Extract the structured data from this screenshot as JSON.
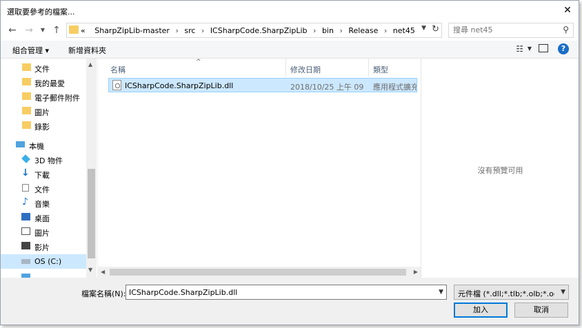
{
  "window": {
    "title": "選取要參考的檔案..."
  },
  "address": {
    "overflow": "«",
    "crumbs": [
      "SharpZipLib-master",
      "src",
      "ICSharpCode.SharpZipLib",
      "bin",
      "Release",
      "net45"
    ],
    "search_placeholder": "搜尋 net45"
  },
  "toolbar": {
    "organize": "組合管理 ▾",
    "new_folder": "新增資料夾",
    "help": "?"
  },
  "sidebar": {
    "items": [
      {
        "label": "文件",
        "icon": "folder"
      },
      {
        "label": "我的最愛",
        "icon": "folder"
      },
      {
        "label": "電子郵件附件",
        "icon": "folder"
      },
      {
        "label": "圖片",
        "icon": "folder"
      },
      {
        "label": "錄影",
        "icon": "folder"
      },
      {
        "label": "本機",
        "icon": "computer"
      },
      {
        "label": "3D 物件",
        "icon": "3d-objects"
      },
      {
        "label": "下載",
        "icon": "download"
      },
      {
        "label": "文件",
        "icon": "document"
      },
      {
        "label": "音樂",
        "icon": "music"
      },
      {
        "label": "桌面",
        "icon": "desktop"
      },
      {
        "label": "圖片",
        "icon": "pictures"
      },
      {
        "label": "影片",
        "icon": "videos"
      },
      {
        "label": "OS (C:)",
        "icon": "drive"
      }
    ]
  },
  "files": {
    "columns": {
      "name": "名稱",
      "modified": "修改日期",
      "type": "類型"
    },
    "rows": [
      {
        "name": "ICSharpCode.SharpZipLib.dll",
        "modified": "2018/10/25 上午 09",
        "type": "應用程式擴充"
      }
    ]
  },
  "preview": {
    "message": "沒有預覽可用"
  },
  "footer": {
    "filename_label": "檔案名稱(N):",
    "filename_value": "ICSharpCode.SharpZipLib.dll",
    "filter_value": "元件檔 (*.dll;*.tlb;*.olb;*.ocx;*.",
    "add_button": "加入",
    "cancel_button": "取消"
  }
}
